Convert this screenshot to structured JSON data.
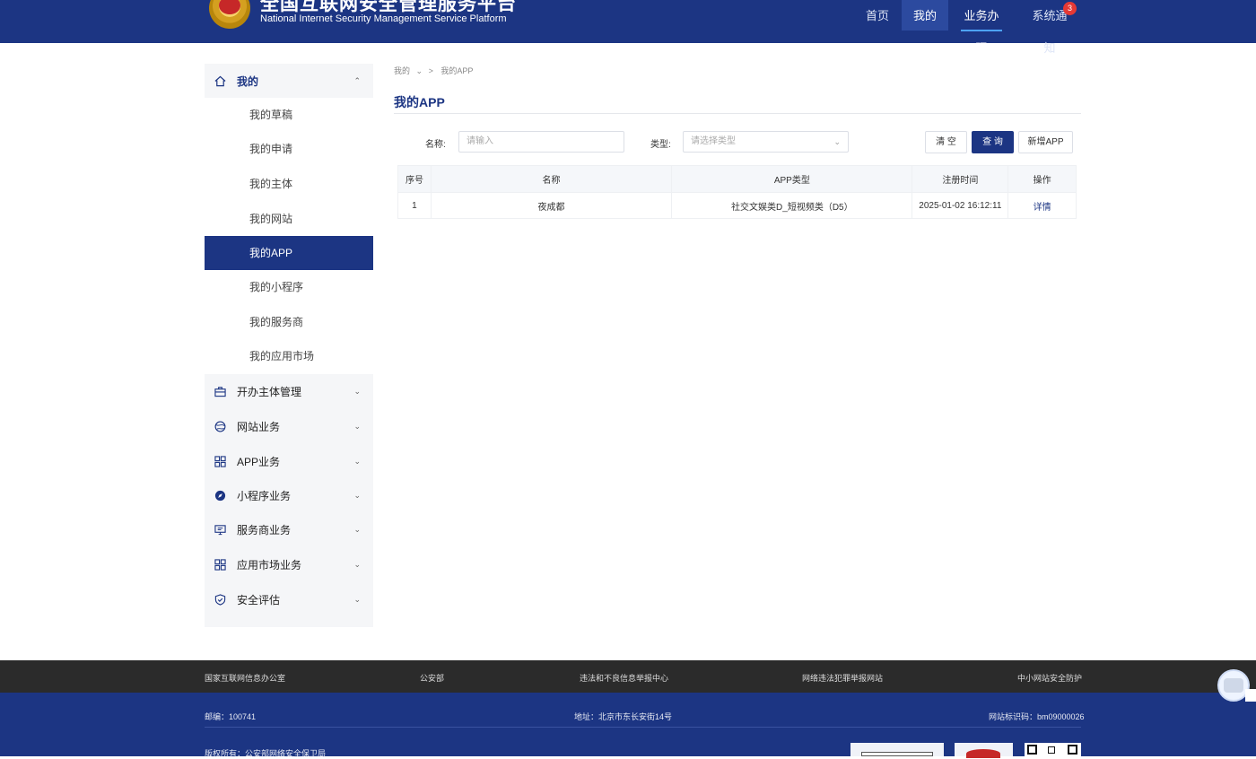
{
  "header": {
    "title": "全国互联网安全管理服务平台",
    "subtitle": "National Internet Security Management Service Platform",
    "nav": [
      {
        "label": "首页"
      },
      {
        "label": "我的"
      },
      {
        "label": "业务办理"
      },
      {
        "label": "系统通知"
      }
    ],
    "notification_count": "3"
  },
  "sidebar": {
    "groups": [
      {
        "label": "我的",
        "icon": "home-icon",
        "chevron": "⌃"
      },
      {
        "label": "开办主体管理",
        "icon": "briefcase-icon",
        "chevron": "⌄"
      },
      {
        "label": "网站业务",
        "icon": "globe-icon",
        "chevron": "⌄"
      },
      {
        "label": "APP业务",
        "icon": "grid-icon",
        "chevron": "⌄"
      },
      {
        "label": "小程序业务",
        "icon": "compass-icon",
        "chevron": "⌄"
      },
      {
        "label": "服务商业务",
        "icon": "monitor-icon",
        "chevron": "⌄"
      },
      {
        "label": "应用市场业务",
        "icon": "grid-icon",
        "chevron": "⌄"
      },
      {
        "label": "安全评估",
        "icon": "shield-icon",
        "chevron": "⌄"
      }
    ],
    "submenu": [
      {
        "label": "我的草稿"
      },
      {
        "label": "我的申请"
      },
      {
        "label": "我的主体"
      },
      {
        "label": "我的网站"
      },
      {
        "label": "我的APP"
      },
      {
        "label": "我的小程序"
      },
      {
        "label": "我的服务商"
      },
      {
        "label": "我的应用市场"
      }
    ]
  },
  "breadcrumb": {
    "root": "我的",
    "sep": ">",
    "current": "我的APP"
  },
  "page_title": "我的APP",
  "filters": {
    "name_label": "名称:",
    "name_placeholder": "请输入",
    "type_label": "类型:",
    "type_placeholder": "请选择类型"
  },
  "buttons": {
    "clear": "清 空",
    "query": "查 询",
    "add": "新增APP"
  },
  "table": {
    "headers": [
      "序号",
      "名称",
      "APP类型",
      "注册时间",
      "操作"
    ],
    "rows": [
      [
        "1",
        "夜成都",
        "社交文娱类D_短视频类（D5）",
        "2025-01-02 16:12:11",
        "详情"
      ]
    ]
  },
  "footer": {
    "links": [
      "国家互联网信息办公室",
      "公安部",
      "违法和不良信息举报中心",
      "网络违法犯罪举报网站",
      "中小网站安全防护"
    ],
    "postcode": "邮编：100741",
    "address": "地址：北京市东长安街14号",
    "site_id": "网站标识码：bm09000026",
    "copyright": "版权所有：公安部网络安全保卫局"
  },
  "colors": {
    "primary": "#1c3583",
    "footer_dark": "#2b2b2b",
    "badge": "#e53935"
  }
}
